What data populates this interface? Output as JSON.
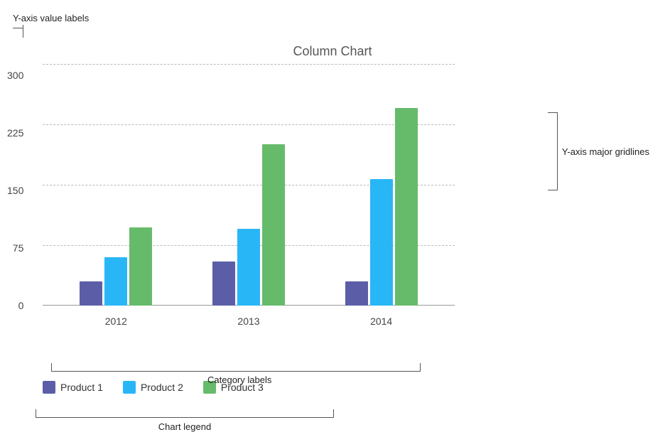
{
  "chart": {
    "title": "Column Chart",
    "yAxis": {
      "labels": [
        "300",
        "225",
        "150",
        "75",
        "0"
      ],
      "annotation": "Y-axis value labels",
      "gridlinesAnnotation": "Y-axis major gridlines"
    },
    "xAxis": {
      "labels": [
        "2012",
        "2013",
        "2014"
      ],
      "categoryAnnotation": "Category labels"
    },
    "legend": {
      "annotation": "Chart legend",
      "items": [
        {
          "label": "Product 1",
          "color": "#5b5ea6"
        },
        {
          "label": "Product 2",
          "color": "#29b6f6"
        },
        {
          "label": "Product 3",
          "color": "#66bb6a"
        }
      ]
    },
    "series": {
      "product1": {
        "label": "Product 1",
        "color": "#5b5ea6",
        "values": [
          30,
          55,
          30
        ]
      },
      "product2": {
        "label": "Product 2",
        "color": "#29b6f6",
        "values": [
          60,
          95,
          157
        ]
      },
      "product3": {
        "label": "Product 3",
        "color": "#66bb6a",
        "values": [
          97,
          200,
          245
        ]
      }
    },
    "maxValue": 300
  },
  "annotations": {
    "yAxisLabel": "Y-axis value labels",
    "yAxisGridlines": "Y-axis major gridlines",
    "categoryLabels": "Category labels",
    "chartLegend": "Chart legend"
  }
}
